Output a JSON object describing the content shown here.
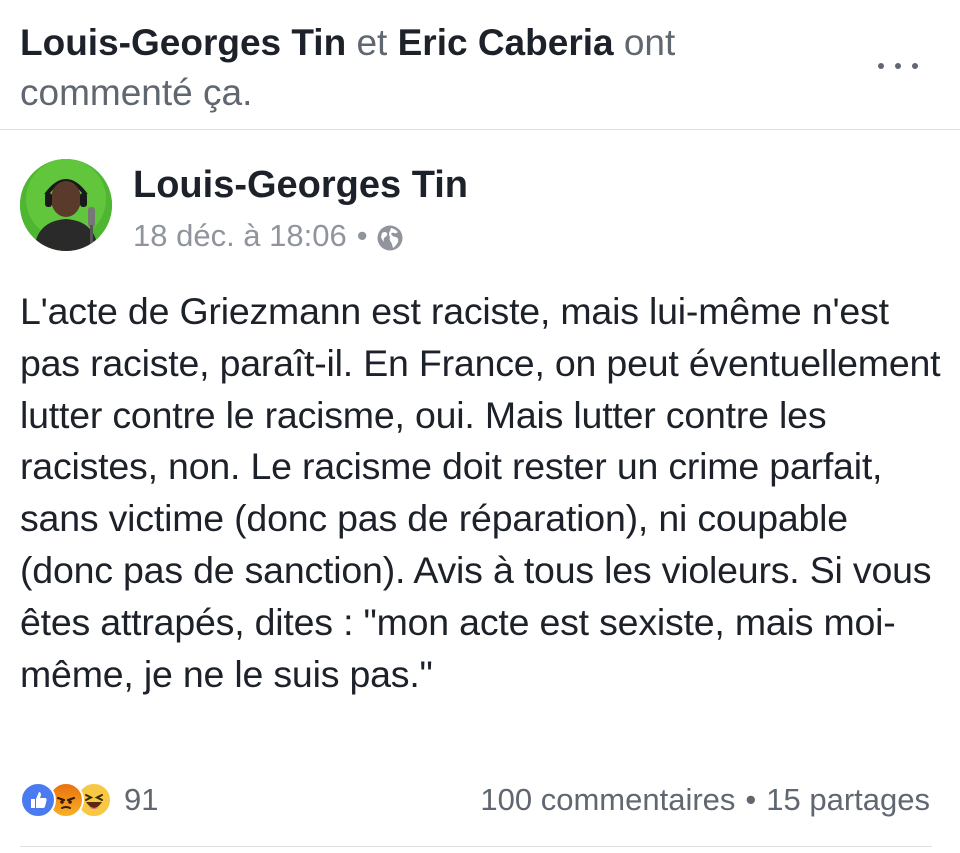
{
  "story": {
    "actor1": "Louis-Georges Tin",
    "conj": "et",
    "actor2": "Eric Caberia",
    "action_part1": "ont",
    "action_part2": "commenté ça."
  },
  "post": {
    "author": "Louis-Georges Tin",
    "timestamp": "18 déc. à 18:06",
    "separator": "•",
    "privacy_icon": "globe-icon",
    "body": "L'acte de Griezmann est raciste, mais lui-même n'est pas raciste, paraît-il. En France, on peut éventuellement lutter contre le racisme, oui. Mais lutter contre les racistes, non. Le racisme doit rester un crime parfait, sans victime (donc pas de réparation), ni coupable (donc pas de sanction). Avis à tous les violeurs. Si vous êtes attrapés, dites : \"mon acte est sexiste, mais moi-même, je ne le suis pas.\""
  },
  "reactions": {
    "icons": [
      "like-icon",
      "angry-icon",
      "haha-icon"
    ],
    "count": "91"
  },
  "counts": {
    "comments": "100 commentaires",
    "separator": "•",
    "shares": "15 partages"
  },
  "colors": {
    "primary_text": "#1d2129",
    "secondary_text": "#606770",
    "meta_text": "#90949c",
    "like_blue": "#4a7bf0",
    "divider": "#dddfe2"
  }
}
